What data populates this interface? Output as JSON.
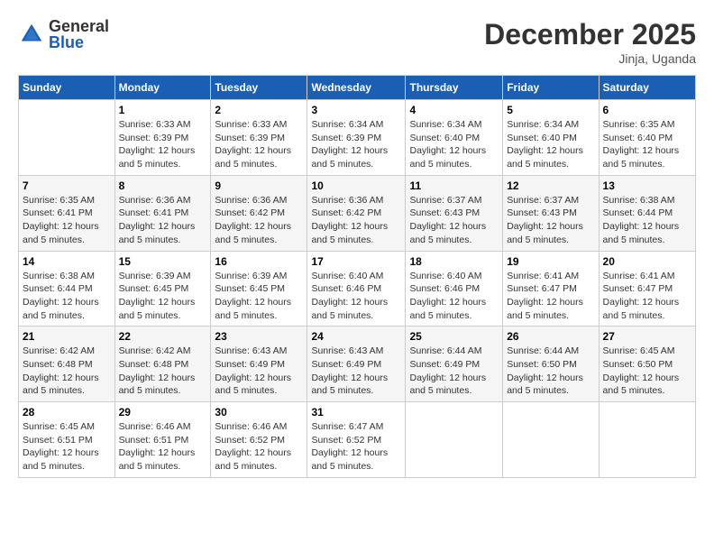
{
  "header": {
    "logo_general": "General",
    "logo_blue": "Blue",
    "month_title": "December 2025",
    "location": "Jinja, Uganda"
  },
  "days_of_week": [
    "Sunday",
    "Monday",
    "Tuesday",
    "Wednesday",
    "Thursday",
    "Friday",
    "Saturday"
  ],
  "weeks": [
    [
      {
        "day": "",
        "info": ""
      },
      {
        "day": "1",
        "info": "Sunrise: 6:33 AM\nSunset: 6:39 PM\nDaylight: 12 hours\nand 5 minutes."
      },
      {
        "day": "2",
        "info": "Sunrise: 6:33 AM\nSunset: 6:39 PM\nDaylight: 12 hours\nand 5 minutes."
      },
      {
        "day": "3",
        "info": "Sunrise: 6:34 AM\nSunset: 6:39 PM\nDaylight: 12 hours\nand 5 minutes."
      },
      {
        "day": "4",
        "info": "Sunrise: 6:34 AM\nSunset: 6:40 PM\nDaylight: 12 hours\nand 5 minutes."
      },
      {
        "day": "5",
        "info": "Sunrise: 6:34 AM\nSunset: 6:40 PM\nDaylight: 12 hours\nand 5 minutes."
      },
      {
        "day": "6",
        "info": "Sunrise: 6:35 AM\nSunset: 6:40 PM\nDaylight: 12 hours\nand 5 minutes."
      }
    ],
    [
      {
        "day": "7",
        "info": "Sunrise: 6:35 AM\nSunset: 6:41 PM\nDaylight: 12 hours\nand 5 minutes."
      },
      {
        "day": "8",
        "info": "Sunrise: 6:36 AM\nSunset: 6:41 PM\nDaylight: 12 hours\nand 5 minutes."
      },
      {
        "day": "9",
        "info": "Sunrise: 6:36 AM\nSunset: 6:42 PM\nDaylight: 12 hours\nand 5 minutes."
      },
      {
        "day": "10",
        "info": "Sunrise: 6:36 AM\nSunset: 6:42 PM\nDaylight: 12 hours\nand 5 minutes."
      },
      {
        "day": "11",
        "info": "Sunrise: 6:37 AM\nSunset: 6:43 PM\nDaylight: 12 hours\nand 5 minutes."
      },
      {
        "day": "12",
        "info": "Sunrise: 6:37 AM\nSunset: 6:43 PM\nDaylight: 12 hours\nand 5 minutes."
      },
      {
        "day": "13",
        "info": "Sunrise: 6:38 AM\nSunset: 6:44 PM\nDaylight: 12 hours\nand 5 minutes."
      }
    ],
    [
      {
        "day": "14",
        "info": "Sunrise: 6:38 AM\nSunset: 6:44 PM\nDaylight: 12 hours\nand 5 minutes."
      },
      {
        "day": "15",
        "info": "Sunrise: 6:39 AM\nSunset: 6:45 PM\nDaylight: 12 hours\nand 5 minutes."
      },
      {
        "day": "16",
        "info": "Sunrise: 6:39 AM\nSunset: 6:45 PM\nDaylight: 12 hours\nand 5 minutes."
      },
      {
        "day": "17",
        "info": "Sunrise: 6:40 AM\nSunset: 6:46 PM\nDaylight: 12 hours\nand 5 minutes."
      },
      {
        "day": "18",
        "info": "Sunrise: 6:40 AM\nSunset: 6:46 PM\nDaylight: 12 hours\nand 5 minutes."
      },
      {
        "day": "19",
        "info": "Sunrise: 6:41 AM\nSunset: 6:47 PM\nDaylight: 12 hours\nand 5 minutes."
      },
      {
        "day": "20",
        "info": "Sunrise: 6:41 AM\nSunset: 6:47 PM\nDaylight: 12 hours\nand 5 minutes."
      }
    ],
    [
      {
        "day": "21",
        "info": "Sunrise: 6:42 AM\nSunset: 6:48 PM\nDaylight: 12 hours\nand 5 minutes."
      },
      {
        "day": "22",
        "info": "Sunrise: 6:42 AM\nSunset: 6:48 PM\nDaylight: 12 hours\nand 5 minutes."
      },
      {
        "day": "23",
        "info": "Sunrise: 6:43 AM\nSunset: 6:49 PM\nDaylight: 12 hours\nand 5 minutes."
      },
      {
        "day": "24",
        "info": "Sunrise: 6:43 AM\nSunset: 6:49 PM\nDaylight: 12 hours\nand 5 minutes."
      },
      {
        "day": "25",
        "info": "Sunrise: 6:44 AM\nSunset: 6:49 PM\nDaylight: 12 hours\nand 5 minutes."
      },
      {
        "day": "26",
        "info": "Sunrise: 6:44 AM\nSunset: 6:50 PM\nDaylight: 12 hours\nand 5 minutes."
      },
      {
        "day": "27",
        "info": "Sunrise: 6:45 AM\nSunset: 6:50 PM\nDaylight: 12 hours\nand 5 minutes."
      }
    ],
    [
      {
        "day": "28",
        "info": "Sunrise: 6:45 AM\nSunset: 6:51 PM\nDaylight: 12 hours\nand 5 minutes."
      },
      {
        "day": "29",
        "info": "Sunrise: 6:46 AM\nSunset: 6:51 PM\nDaylight: 12 hours\nand 5 minutes."
      },
      {
        "day": "30",
        "info": "Sunrise: 6:46 AM\nSunset: 6:52 PM\nDaylight: 12 hours\nand 5 minutes."
      },
      {
        "day": "31",
        "info": "Sunrise: 6:47 AM\nSunset: 6:52 PM\nDaylight: 12 hours\nand 5 minutes."
      },
      {
        "day": "",
        "info": ""
      },
      {
        "day": "",
        "info": ""
      },
      {
        "day": "",
        "info": ""
      }
    ]
  ]
}
